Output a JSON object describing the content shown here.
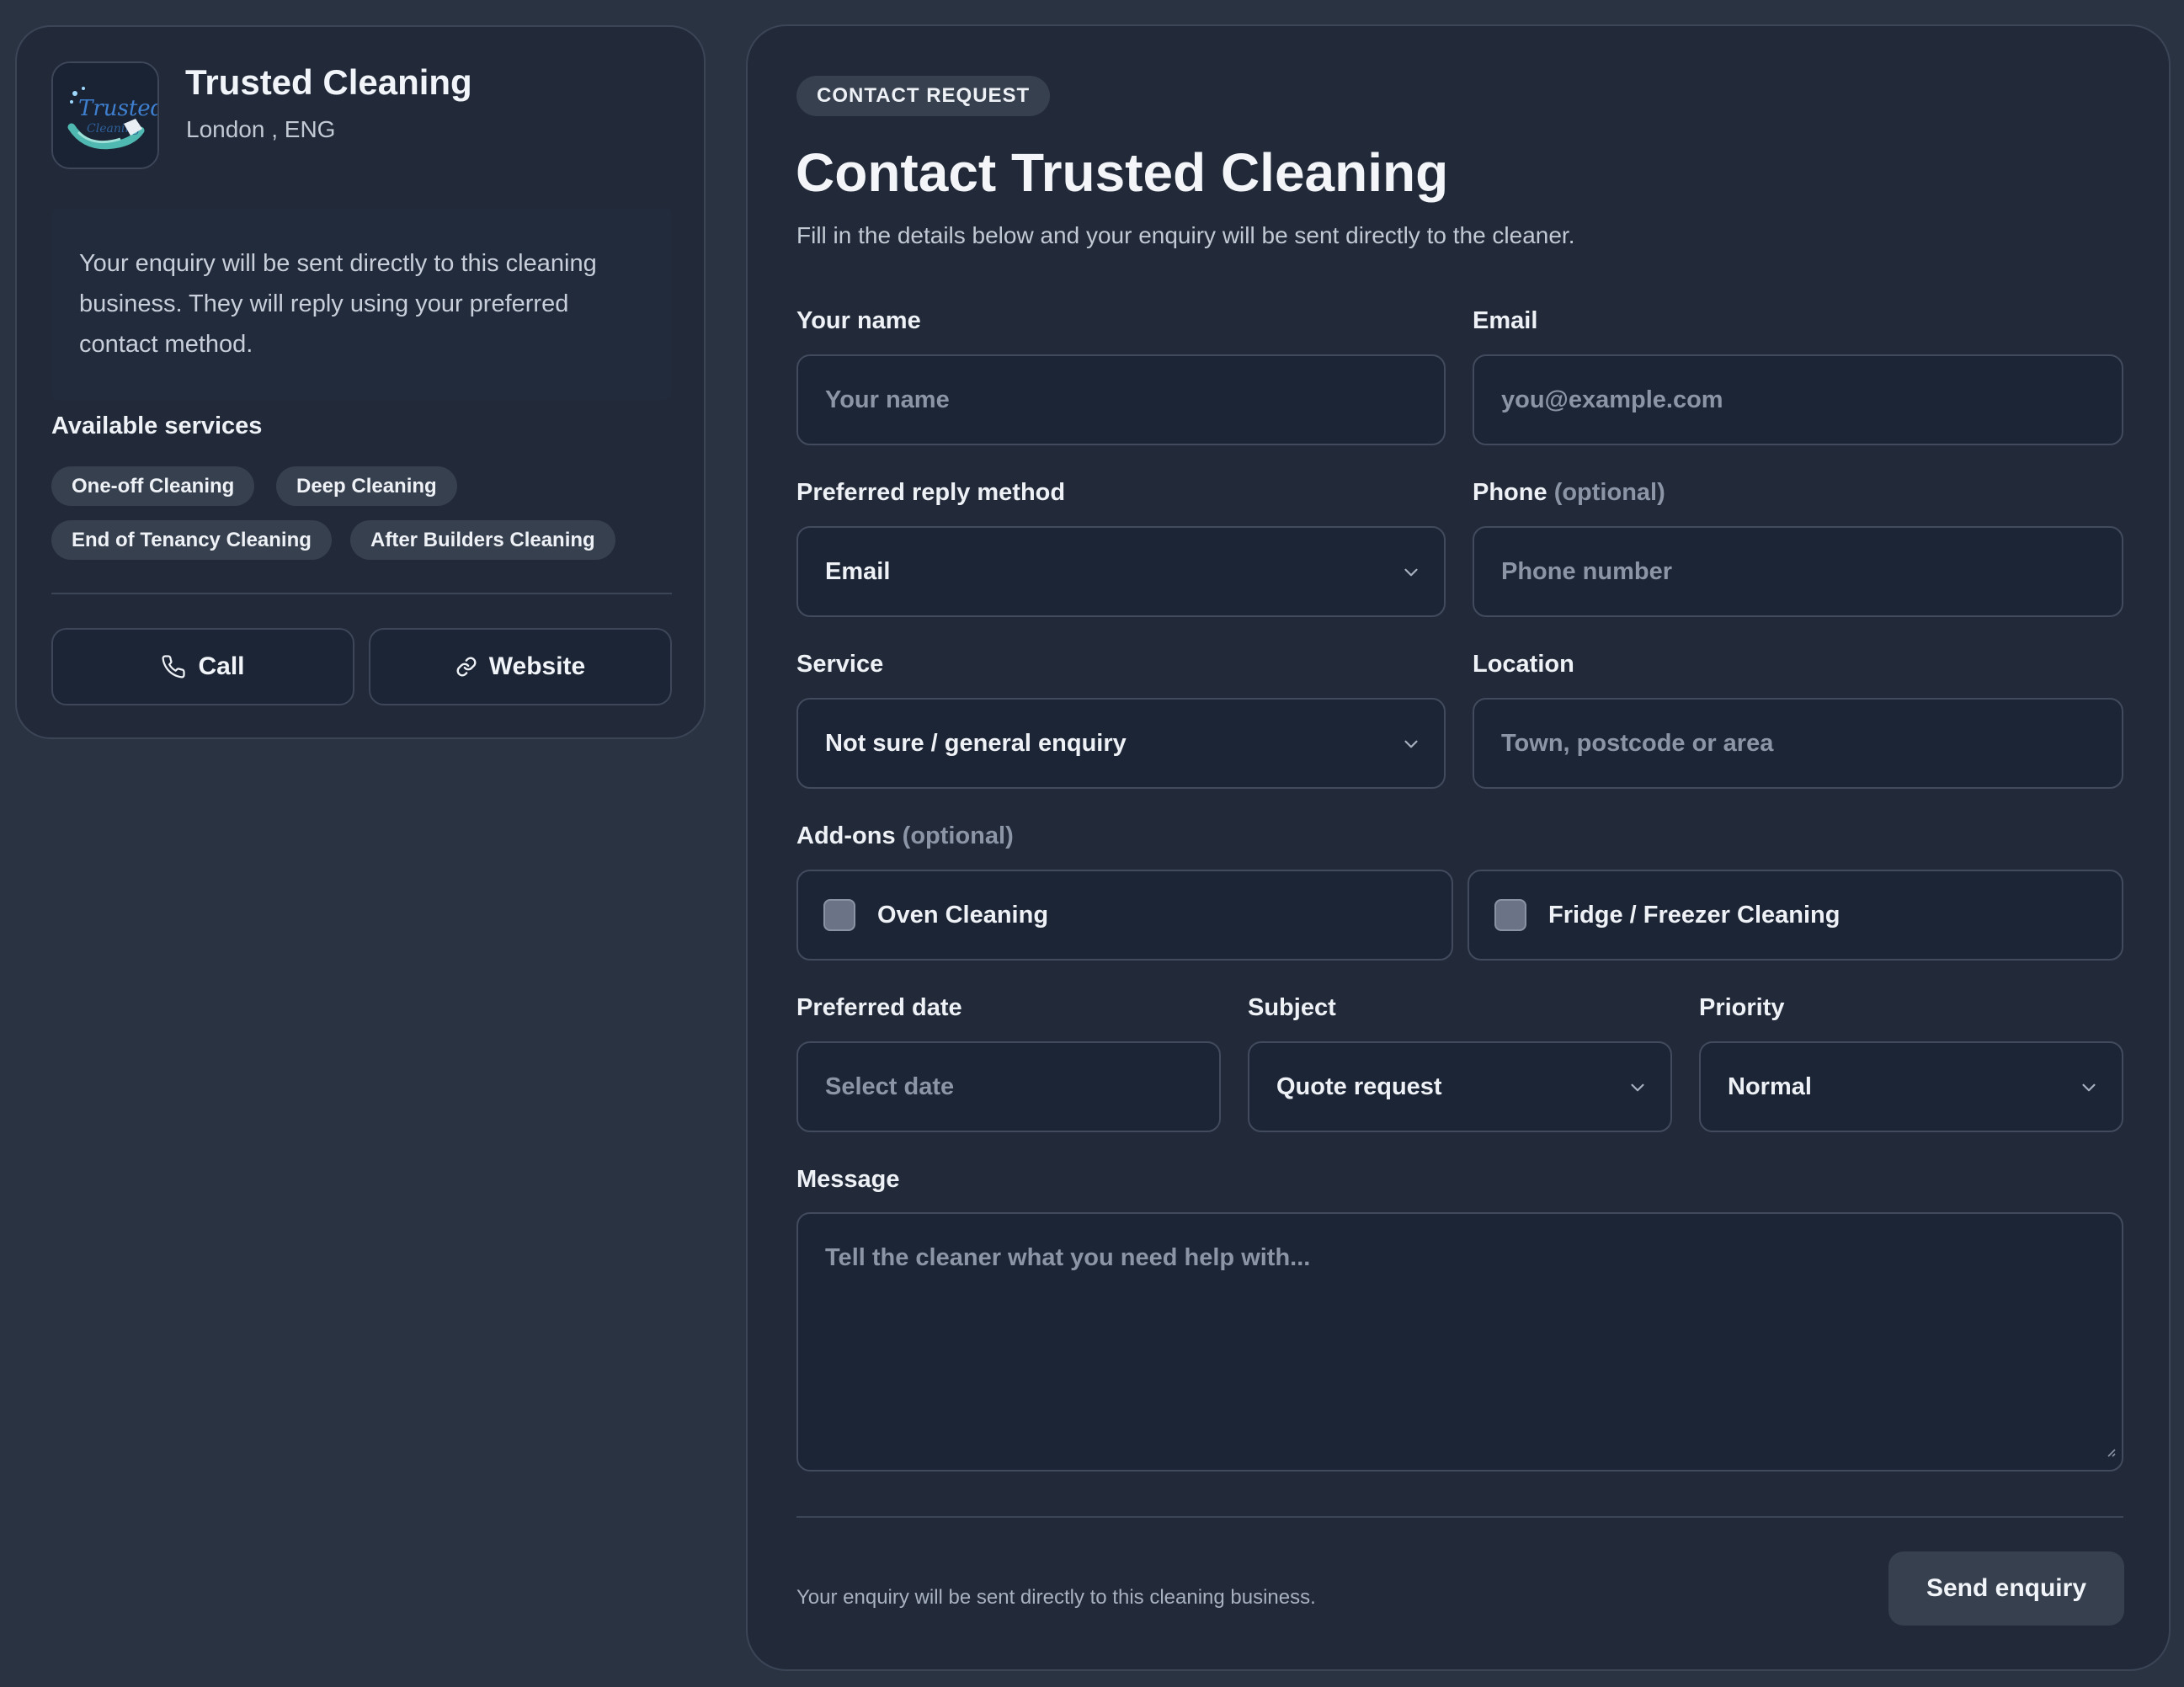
{
  "business": {
    "name": "Trusted Cleaning",
    "location": "London , ENG",
    "note": "Your enquiry will be sent directly to this cleaning business. They will reply using your preferred contact method.",
    "services_heading": "Available services",
    "services": [
      "One-off Cleaning",
      "Deep Cleaning",
      "End of Tenancy Cleaning",
      "After Builders Cleaning"
    ],
    "call_label": "Call",
    "website_label": "Website"
  },
  "form": {
    "badge": "CONTACT REQUEST",
    "title": "Contact Trusted Cleaning",
    "subtitle": "Fill in the details below and your enquiry will be sent directly to the cleaner.",
    "name": {
      "label": "Your name",
      "placeholder": "Your name"
    },
    "email": {
      "label": "Email",
      "placeholder": "you@example.com"
    },
    "reply_method": {
      "label": "Preferred reply method",
      "value": "Email"
    },
    "phone": {
      "label": "Phone",
      "optional": "(optional)",
      "placeholder": "Phone number"
    },
    "service": {
      "label": "Service",
      "value": "Not sure / general enquiry"
    },
    "location": {
      "label": "Location",
      "placeholder": "Town, postcode or area"
    },
    "addons": {
      "label": "Add-ons",
      "optional": "(optional)",
      "items": [
        "Oven Cleaning",
        "Fridge / Freezer Cleaning"
      ]
    },
    "date": {
      "label": "Preferred date",
      "placeholder": "Select date"
    },
    "subject": {
      "label": "Subject",
      "value": "Quote request"
    },
    "priority": {
      "label": "Priority",
      "value": "Normal"
    },
    "message": {
      "label": "Message",
      "placeholder": "Tell the cleaner what you need help with..."
    },
    "footer_note": "Your enquiry will be sent directly to this cleaning business.",
    "submit_label": "Send enquiry"
  }
}
